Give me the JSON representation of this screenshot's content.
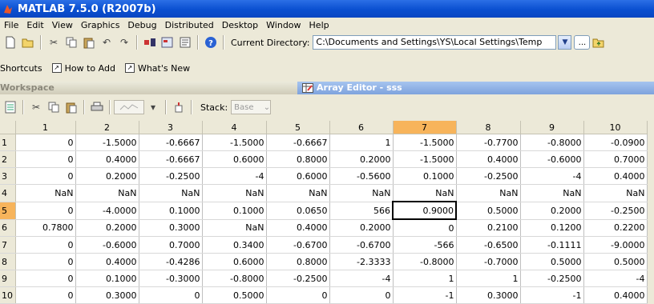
{
  "window": {
    "title": "MATLAB  7.5.0 (R2007b)"
  },
  "menu": [
    "File",
    "Edit",
    "View",
    "Graphics",
    "Debug",
    "Distributed",
    "Desktop",
    "Window",
    "Help"
  ],
  "toolbar": {
    "current_directory_label": "Current Directory:",
    "current_directory_value": "C:\\Documents and Settings\\YS\\Local Settings\\Temp",
    "browse_label": "...",
    "icons": [
      "new-file-icon",
      "open-folder-icon",
      "cut-icon",
      "copy-icon",
      "paste-icon",
      "undo-icon",
      "redo-icon",
      "simulink-icon",
      "guide-icon",
      "profiler-icon",
      "help-icon"
    ]
  },
  "shortcuts": {
    "label": "Shortcuts",
    "items": [
      "How to Add",
      "What's New"
    ]
  },
  "panels": {
    "workspace_title": "Workspace",
    "array_editor_title": "Array Editor - sss"
  },
  "editor_toolbar": {
    "stack_label": "Stack:",
    "stack_value": "Base"
  },
  "grid": {
    "columns": [
      "1",
      "2",
      "3",
      "4",
      "5",
      "6",
      "7",
      "8",
      "9",
      "10"
    ],
    "selected_column": 7,
    "selected_row": 5,
    "rows": [
      {
        "label": "1",
        "cells": [
          "0",
          "-1.5000",
          "-0.6667",
          "-1.5000",
          "-0.6667",
          "1",
          "-1.5000",
          "-0.7700",
          "-0.8000",
          "-0.0900"
        ]
      },
      {
        "label": "2",
        "cells": [
          "0",
          "0.4000",
          "-0.6667",
          "0.6000",
          "0.8000",
          "0.2000",
          "-1.5000",
          "0.4000",
          "-0.6000",
          "0.7000"
        ]
      },
      {
        "label": "3",
        "cells": [
          "0",
          "0.2000",
          "-0.2500",
          "-4",
          "0.6000",
          "-0.5600",
          "0.1000",
          "-0.2500",
          "-4",
          "0.4000"
        ]
      },
      {
        "label": "4",
        "cells": [
          "NaN",
          "NaN",
          "NaN",
          "NaN",
          "NaN",
          "NaN",
          "NaN",
          "NaN",
          "NaN",
          "NaN"
        ]
      },
      {
        "label": "5",
        "cells": [
          "0",
          "-4.0000",
          "0.1000",
          "0.1000",
          "0.0650",
          "566",
          "0.9000",
          "0.5000",
          "0.2000",
          "-0.2500"
        ]
      },
      {
        "label": "6",
        "cells": [
          "0.7800",
          "0.2000",
          "0.3000",
          "NaN",
          "0.4000",
          "0.2000",
          "0",
          "0.2100",
          "0.1200",
          "0.2200"
        ]
      },
      {
        "label": "7",
        "cells": [
          "0",
          "-0.6000",
          "0.7000",
          "0.3400",
          "-0.6700",
          "-0.6700",
          "-566",
          "-0.6500",
          "-0.1111",
          "-9.0000"
        ]
      },
      {
        "label": "8",
        "cells": [
          "0",
          "0.4000",
          "-0.4286",
          "0.6000",
          "0.8000",
          "-2.3333",
          "-0.8000",
          "-0.7000",
          "0.5000",
          "0.5000"
        ]
      },
      {
        "label": "9",
        "cells": [
          "0",
          "0.1000",
          "-0.3000",
          "-0.8000",
          "-0.2500",
          "-4",
          "1",
          "1",
          "-0.2500",
          "-4"
        ]
      },
      {
        "label": "10",
        "cells": [
          "0",
          "0.3000",
          "0",
          "0.5000",
          "0",
          "0",
          "-1",
          "0.3000",
          "-1",
          "0.4000"
        ]
      }
    ]
  }
}
